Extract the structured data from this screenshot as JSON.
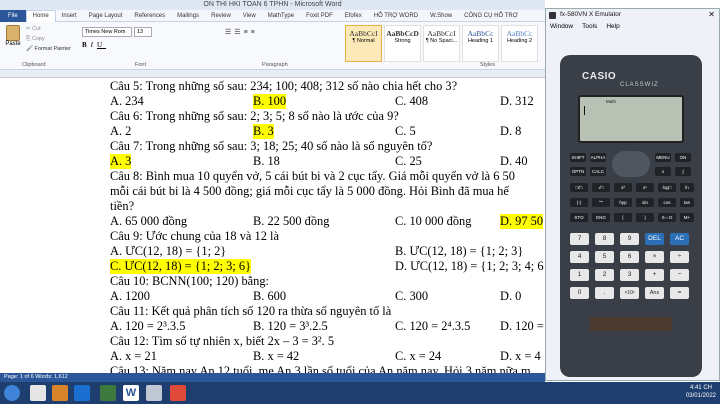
{
  "word": {
    "title": "ON THI HKI TOAN 6 TPHN - Microsoft Word",
    "tabs": [
      "File",
      "Home",
      "Insert",
      "Page Layout",
      "References",
      "Mailings",
      "Review",
      "View",
      "MathType",
      "Foxit PDF",
      "Efofex",
      "HỖ TRỢ WORD",
      "W.Show",
      "CÔNG CỤ HỖ TRỢ"
    ],
    "font_name": "Times New Rom",
    "font_size": "13",
    "paste_label": "Paste",
    "cut_label": "Cut",
    "copy_label": "Copy",
    "format_painter_label": "Format Painter",
    "clipboard_label": "Clipboard",
    "font_label": "Font",
    "paragraph_label": "Paragraph",
    "styles_label": "Styles",
    "styles": [
      {
        "preview": "AaBbCcI",
        "name": "¶ Normal"
      },
      {
        "preview": "AaBbCcD",
        "name": "Strong"
      },
      {
        "preview": "AaBbCcI",
        "name": "¶ No Spaci..."
      },
      {
        "preview": "AaBbCc",
        "name": "Heading 1"
      },
      {
        "preview": "AaBbCc",
        "name": "Heading 2"
      }
    ],
    "status": "Page: 1 of 6   Words: 1,612",
    "doc": {
      "l0": "Câu 5: Trong những số sau: 234; 100; 408; 312 số nào chia hết cho 3?",
      "q5": [
        "A. 234",
        "B. 100",
        "C. 408",
        "D. 312"
      ],
      "l2": "Câu 6: Trong những số sau: 2; 3; 5; 8 số nào là ước của 9?",
      "q6": [
        "A. 2",
        "B. 3",
        "C. 5",
        "D. 8"
      ],
      "l4": "Câu 7: Trong những số sau: 3; 18; 25; 40 số nào là số nguyên tố?",
      "q7": [
        "A. 3",
        "B. 18",
        "C. 25",
        "D. 40"
      ],
      "l6": "Câu 8: Bình mua 10 quyển vở, 5 cái bút bi và 2 cục tẩy. Giá mỗi quyển vở là 6 50",
      "l7": "mỗi cái bút bi là 4 500 đồng; giá mỗi cục tẩy là 5 000 đồng. Hỏi Bình đã mua hế",
      "l8": "tiền?",
      "q8": [
        "A. 65 000 đồng",
        "B. 22 500 đồng",
        "C. 10 000 đồng",
        "D. 97 50"
      ],
      "l10": "Câu 9: Ước chung của 18 và 12 là",
      "q9a": [
        "A. ƯC(12, 18) = {1; 2}",
        "B. ƯC(12, 18) = {1; 2; 3}"
      ],
      "q9b": [
        "C. ƯC(12, 18) = {1; 2; 3; 6}",
        "D. ƯC(12, 18) = {1; 2; 3; 4; 6"
      ],
      "l13": "Câu 10: BCNN(100; 120) bằng:",
      "q10": [
        "A. 1200",
        "B. 600",
        "C. 300",
        "D. 0"
      ],
      "l15": "Câu 11: Kết quả phân tích số 120 ra thừa số nguyên tố là",
      "q11": [
        "A. 120 = 2³.3.5",
        "B. 120 = 3³.2.5",
        "C. 120 = 2⁴.3.5",
        "D. 120 = "
      ],
      "l17": "Câu 12: Tìm số tự nhiên x, biết 2x – 3 = 3². 5",
      "q12": [
        "A. x = 21",
        "B. x = 42",
        "C. x = 24",
        "D. x = 4"
      ],
      "l19": "Câu 13: Năm nay An 12 tuổi, mẹ An 3 lần số tuổi của An năm nay. Hỏi 3 năm nữa m"
    }
  },
  "emulator": {
    "title": "fx-580VN X Emulator",
    "menu": [
      "Window",
      "Tools",
      "Help"
    ],
    "brand": "CASIO",
    "model": "CLASSWIZ",
    "screen_indicator": "Math",
    "keys": [
      "SHIFT",
      "ALPHA",
      "MENU",
      "ON",
      "OPTN",
      "CALC",
      "x",
      "□/□",
      "√□",
      "x²",
      "xⁿ",
      "log□",
      "ln",
      "(-)",
      "°'\"",
      "hyp",
      "sin",
      "cos",
      "tan",
      "STO",
      "ENG",
      "(",
      ")",
      "S⇔D",
      "M+",
      "7",
      "8",
      "9",
      "DEL",
      "AC",
      "4",
      "5",
      "6",
      "×",
      "÷",
      "1",
      "2",
      "3",
      "+",
      "−",
      "0",
      ".",
      "×10ˣ",
      "Ans",
      "="
    ]
  },
  "taskbar": {
    "time": "4:41 CH",
    "date": "03/01/2022"
  },
  "colors": {
    "highlight": "#ffff00",
    "word_blue": "#2b579a",
    "taskbar": "#1d3e6e"
  }
}
